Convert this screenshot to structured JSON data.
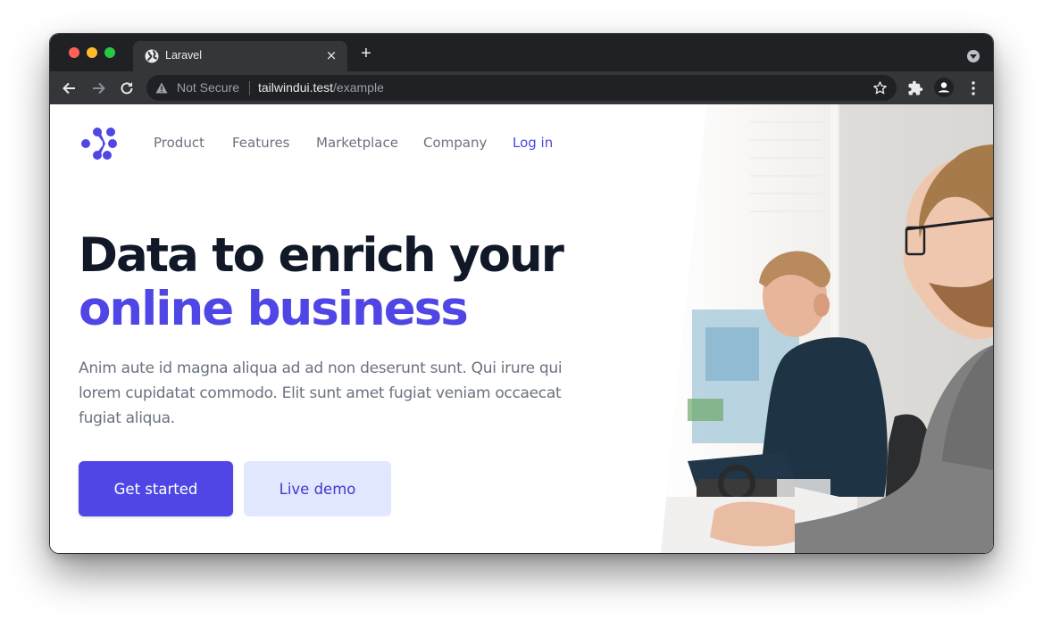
{
  "browser": {
    "tab": {
      "title": "Laravel",
      "favicon": "globe-icon"
    },
    "new_tab_symbol": "+",
    "close_symbol": "×",
    "address_bar": {
      "security_label": "Not Secure",
      "host": "tailwindui.test",
      "path": "/example"
    },
    "icons": [
      "arrow-left-icon",
      "arrow-right-icon",
      "reload-icon",
      "warning-icon",
      "star-icon",
      "puzzle-icon",
      "profile-icon",
      "kebab-menu-icon",
      "tab-search-icon"
    ]
  },
  "page": {
    "logo": "workflow-logo",
    "nav": {
      "items": [
        {
          "label": "Product"
        },
        {
          "label": "Features"
        },
        {
          "label": "Marketplace"
        },
        {
          "label": "Company"
        }
      ],
      "login_label": "Log in"
    },
    "hero": {
      "headline_line1": "Data to enrich your",
      "headline_line2": "online business",
      "lead": "Anim aute id magna aliqua ad ad non deserunt sunt. Qui irure qui lorem cupidatat commodo. Elit sunt amet fugiat veniam occaecat fugiat aliqua.",
      "primary_cta": "Get started",
      "secondary_cta": "Live demo",
      "image_alt": "Two men working at computers in an office"
    },
    "colors": {
      "accent": "#4f46e5",
      "accent_light": "#e0e7ff",
      "heading": "#111827",
      "body_text": "#6b7280"
    }
  }
}
